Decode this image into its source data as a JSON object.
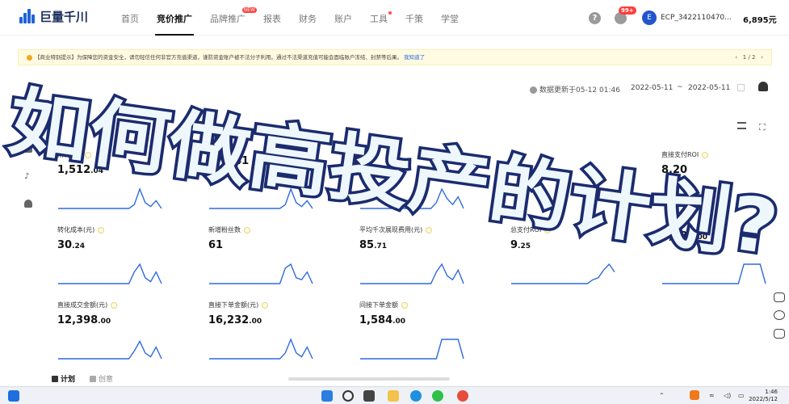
{
  "header": {
    "logo_text": "巨量千川",
    "nav": [
      {
        "label": "首页",
        "active": false
      },
      {
        "label": "竞价推广",
        "active": true
      },
      {
        "label": "品牌推广",
        "active": false,
        "badge": "NEW"
      },
      {
        "label": "报表",
        "active": false
      },
      {
        "label": "财务",
        "active": false
      },
      {
        "label": "账户",
        "active": false
      },
      {
        "label": "工具",
        "active": false,
        "dot": true
      },
      {
        "label": "千策",
        "active": false
      },
      {
        "label": "学堂",
        "active": false
      }
    ],
    "help_icon": "?",
    "message_badge": "99+",
    "avatar_letter": "E",
    "account_name": "ECP_3422110470...",
    "balance": "6,895元"
  },
  "notice": {
    "text": "【商业特别提示】为保障您的资金安全，请勿轻信任何非官方充值渠道，谨防资金账户被不法分子利用。通过不法渠道充值可能会面临账户冻结、封禁等后果。",
    "link": "我知道了",
    "pager": "1  /  2"
  },
  "date_bar": {
    "update_text": "数据更新于05-12 01:46",
    "start_date": "2022-05-11",
    "separator": "~",
    "end_date": "2022-05-11"
  },
  "metrics": [
    {
      "label": "消耗(元)",
      "int": "1,512",
      "dec": ".04",
      "trend": [
        0,
        0,
        0,
        0,
        0,
        0,
        0,
        0,
        0,
        0,
        0,
        0,
        0,
        0,
        0.2,
        1,
        0.3,
        0.1,
        0.4,
        0
      ]
    },
    {
      "label": "",
      "int": "17,641",
      "dec": "",
      "trend": [
        0,
        0,
        0,
        0,
        0,
        0,
        0,
        0,
        0,
        0,
        0,
        0,
        0,
        0,
        0.2,
        1,
        0.3,
        0.1,
        0.4,
        0
      ]
    },
    {
      "label": "",
      "int": "",
      "dec": "",
      "trend": [
        0,
        0,
        0,
        0,
        0,
        0,
        0,
        0,
        0,
        0,
        0,
        0,
        0,
        0,
        0.3,
        1,
        0.5,
        0.2,
        0.6,
        0
      ]
    },
    {
      "label": "",
      "int": "",
      "dec": "",
      "trend": []
    },
    {
      "label": "直接支付ROI",
      "int": "8.20",
      "dec": "",
      "trend": []
    },
    {
      "label": "转化成本(元)",
      "int": "30",
      "dec": ".24",
      "trend": [
        0,
        0,
        0,
        0,
        0,
        0,
        0,
        0,
        0,
        0,
        0,
        0,
        0,
        0,
        0.6,
        1,
        0.3,
        0.1,
        0.6,
        0
      ]
    },
    {
      "label": "新增粉丝数",
      "int": "61",
      "dec": "",
      "trend": [
        0,
        0,
        0,
        0,
        0,
        0,
        0,
        0,
        0,
        0,
        0,
        0,
        0,
        0,
        0.8,
        1,
        0.3,
        0.2,
        0.6,
        0
      ]
    },
    {
      "label": "平均千次展现费用(元)",
      "int": "85",
      "dec": ".71",
      "trend": [
        0,
        0,
        0,
        0,
        0,
        0,
        0,
        0,
        0,
        0,
        0,
        0,
        0,
        0,
        0.6,
        1,
        0.4,
        0.2,
        0.7,
        0
      ]
    },
    {
      "label": "总支付ROI",
      "int": "9",
      "dec": ".25",
      "trend": [
        0,
        0,
        0,
        0,
        0,
        0,
        0,
        0,
        0,
        0,
        0,
        0,
        0,
        0,
        0,
        0.2,
        0.3,
        0.7,
        1,
        0.6
      ]
    },
    {
      "label": "",
      "int": "1,584",
      "dec": ".00",
      "trend": [
        0,
        0,
        0,
        0,
        0,
        0,
        0,
        0,
        0,
        0,
        0,
        0,
        0,
        0,
        0,
        1,
        1,
        1,
        1,
        0
      ]
    },
    {
      "label": "直接成交金额(元)",
      "int": "12,398",
      "dec": ".00",
      "trend": [
        0,
        0,
        0,
        0,
        0,
        0,
        0,
        0,
        0,
        0,
        0,
        0,
        0,
        0,
        0.4,
        0.9,
        0.3,
        0.1,
        0.6,
        0
      ]
    },
    {
      "label": "直接下单金额(元)",
      "int": "16,232",
      "dec": ".00",
      "trend": [
        0,
        0,
        0,
        0,
        0,
        0,
        0,
        0,
        0,
        0,
        0,
        0,
        0,
        0,
        0.3,
        1,
        0.3,
        0.1,
        0.6,
        0
      ]
    },
    {
      "label": "间接下单金额",
      "int": "1,584",
      "dec": ".00",
      "trend": [
        0,
        0,
        0,
        0,
        0,
        0,
        0,
        0,
        0,
        0,
        0,
        0,
        0,
        0,
        0,
        1,
        1,
        1,
        1,
        0
      ]
    }
  ],
  "tabs": [
    {
      "label": "计划",
      "active": true
    },
    {
      "label": "创意",
      "active": false
    }
  ],
  "overlay_title": "如何做高投产的计划?",
  "taskbar": {
    "time": "1:46",
    "date": "2022/5/12"
  },
  "colors": {
    "accent": "#1f63d8",
    "spark": "#2f6be0",
    "overlay_fill": "#eef7fb",
    "overlay_stroke": "#1b2b6e"
  }
}
